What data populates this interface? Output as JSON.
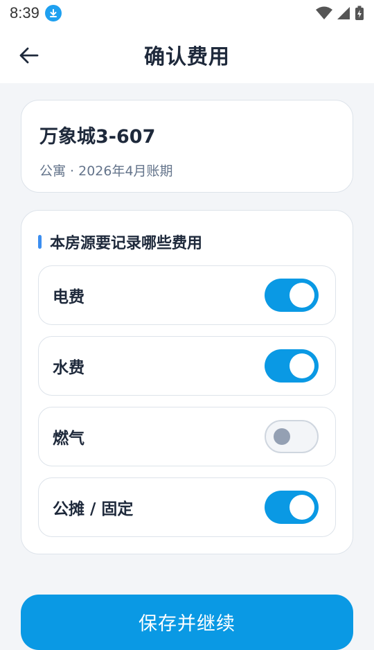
{
  "status_bar": {
    "time": "8:39"
  },
  "header": {
    "title": "确认费用"
  },
  "property": {
    "name": "万象城3-607",
    "subtitle": "公寓 · 2026年4月账期"
  },
  "fees_section": {
    "title": "本房源要记录哪些费用",
    "items": [
      {
        "label": "电费",
        "enabled": true
      },
      {
        "label": "水费",
        "enabled": true
      },
      {
        "label": "燃气",
        "enabled": false
      },
      {
        "label": "公摊 / 固定",
        "enabled": true
      }
    ]
  },
  "actions": {
    "save_label": "保存并继续"
  },
  "colors": {
    "accent": "#0a99e4",
    "section_marker": "#3b8ef0",
    "download_badge": "#1ea0f0"
  }
}
